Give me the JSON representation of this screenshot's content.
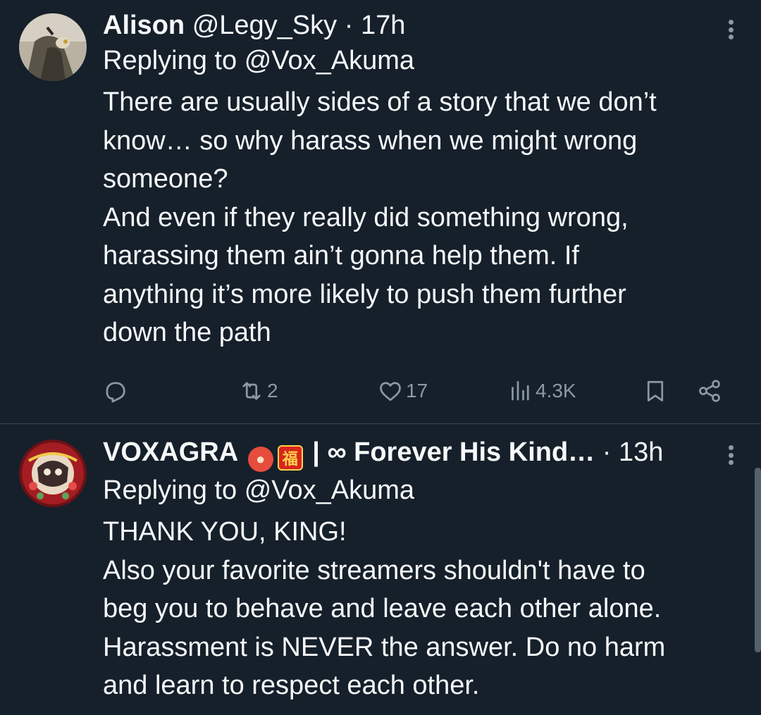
{
  "colors": {
    "background": "#15202b",
    "text_primary": "#f7f9f9",
    "text_secondary": "#8b98a5",
    "divider": "#38444d"
  },
  "tweets": [
    {
      "display_name": "Alison",
      "handle": "@Legy_Sky",
      "separator": "·",
      "time": "17h",
      "reply_prefix": "Replying to",
      "reply_to": "@Vox_Akuma",
      "body": "There are usually sides of a story that we don’t\nknow… so why harass when we might wrong\nsomeone?\nAnd even if they really did something wrong,\nharassing them ain’t gonna help them. If\nanything it’s more likely to push them further\ndown the path",
      "avatar_icon": "user-avatar-photo",
      "more_icon": "more-vertical-icon",
      "actions": {
        "reply": {
          "icon": "reply-icon",
          "count": ""
        },
        "retweet": {
          "icon": "retweet-icon",
          "count": "2"
        },
        "like": {
          "icon": "heart-icon",
          "count": "17"
        },
        "views": {
          "icon": "views-icon",
          "count": "4.3K"
        },
        "bookmark": {
          "icon": "bookmark-icon"
        },
        "share": {
          "icon": "share-icon"
        }
      }
    },
    {
      "display_name": "VOXAGRA",
      "display_name_emoji_1": "ogre-emoji",
      "display_name_emoji_2": "red-envelope-emoji",
      "display_name_suffix": "| ∞ Forever His Kind…",
      "separator": "·",
      "time": "13h",
      "reply_prefix": "Replying to",
      "reply_to": "@Vox_Akuma",
      "body": "THANK YOU, KING!\nAlso your favorite streamers shouldn't have to\nbeg you to behave and leave each other alone.\nHarassment is NEVER the answer. Do no harm\nand learn to respect each other.",
      "avatar_icon": "user-avatar-artwork",
      "more_icon": "more-vertical-icon"
    }
  ]
}
